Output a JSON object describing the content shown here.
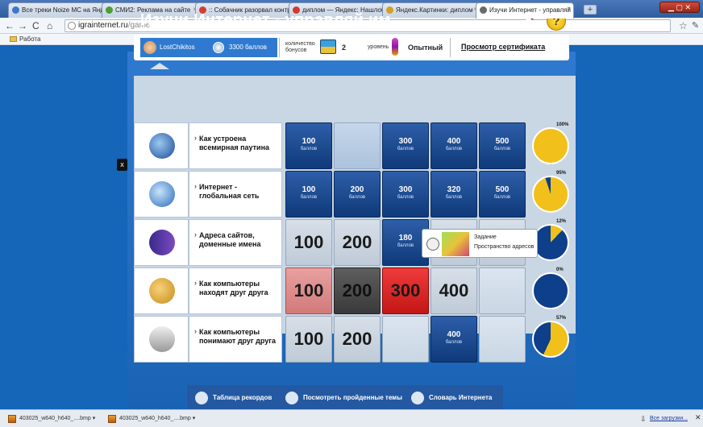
{
  "browser": {
    "tabs": [
      {
        "label": "Все треки Noize MC на Яндекс",
        "color": "#3a78c8"
      },
      {
        "label": "СМИ2: Реклама на сайте",
        "color": "#4aa030"
      },
      {
        "label": ":: Собачник разорвал контра",
        "color": "#d04030"
      },
      {
        "label": "диплом — Яндекс: Нашлось",
        "color": "#d03a2a"
      },
      {
        "label": "Яндекс.Картинки: диплом",
        "color": "#d0a020"
      },
      {
        "label": "Изучи Интернет - управляй",
        "color": "#6a6a6a"
      }
    ],
    "active_tab": 5,
    "url_domain": "igrainternet.ru",
    "url_path": "/game",
    "bookmark": "Работа",
    "win_ctl": "▁ ▢ ✕"
  },
  "game": {
    "title": "Изучи Интернет - управляй им",
    "help_label": "?",
    "user_name": "LostChikitos",
    "score": "3300 баллов",
    "bonus_label": "количество бонусов",
    "bonus_count": "2",
    "level_label": "уровень",
    "level_value": "Опытный",
    "cert_link": "Просмотр сертификата",
    "close_x": "x",
    "rows": [
      {
        "label": "Как устроена всемирная паутина",
        "pct": "100%",
        "progress": 1.0,
        "cells": [
          {
            "style": "blue",
            "value": "100",
            "unit": "баллов"
          },
          {
            "style": "glass",
            "value": "",
            "unit": ""
          },
          {
            "style": "blue",
            "value": "300",
            "unit": "баллов"
          },
          {
            "style": "blue",
            "value": "400",
            "unit": "баллов"
          },
          {
            "style": "blue",
            "value": "500",
            "unit": "баллов"
          }
        ]
      },
      {
        "label": "Интернет - глобальная сеть",
        "pct": "95%",
        "progress": 0.95,
        "cells": [
          {
            "style": "blue",
            "value": "100",
            "unit": "баллов"
          },
          {
            "style": "blue",
            "value": "200",
            "unit": "баллов"
          },
          {
            "style": "blue",
            "value": "300",
            "unit": "баллов"
          },
          {
            "style": "blue",
            "value": "320",
            "unit": "баллов"
          },
          {
            "style": "blue",
            "value": "500",
            "unit": "баллов"
          }
        ]
      },
      {
        "label": "Адреса сайтов, доменные имена",
        "pct": "12%",
        "progress": 0.12,
        "cells": [
          {
            "style": "gray",
            "big": "100"
          },
          {
            "style": "gray",
            "big": "200"
          },
          {
            "style": "blue",
            "value": "180",
            "unit": "баллов"
          },
          {
            "style": "gray",
            "big": ""
          },
          {
            "style": "gray",
            "big": ""
          }
        ]
      },
      {
        "label": "Как компьютеры находят друг друга",
        "pct": "0%",
        "progress": 0.0,
        "cells": [
          {
            "style": "red",
            "big": "100"
          },
          {
            "style": "dark",
            "big": "200"
          },
          {
            "style": "bred",
            "big": "300"
          },
          {
            "style": "gray",
            "big": "400"
          },
          {
            "style": "blank lt",
            "big": ""
          }
        ]
      },
      {
        "label": "Как компьютеры понимают друг друга",
        "pct": "57%",
        "progress": 0.57,
        "cells": [
          {
            "style": "gray",
            "big": "100"
          },
          {
            "style": "gray",
            "big": "200"
          },
          {
            "style": "blank lt",
            "big": ""
          },
          {
            "style": "blue",
            "value": "400",
            "unit": "баллов"
          },
          {
            "style": "blank lt",
            "big": ""
          }
        ]
      }
    ],
    "tooltip": {
      "line1": "Задание",
      "line2": "Пространство адресов"
    },
    "bottom": [
      {
        "label": "Таблица рекордов",
        "icon": "trophy-icon"
      },
      {
        "label": "Посмотреть пройденные темы",
        "icon": "eye-icon"
      },
      {
        "label": "Словарь Интернета",
        "icon": "book-icon"
      }
    ],
    "colors": {
      "page_bg": "#1565b9",
      "pie_fill": "#f2c01a",
      "pie_bg": "#0d3f8a",
      "cell_blue": "#123f80"
    }
  },
  "downloads": {
    "items": [
      "403025_w640_h640_....bmp",
      "403025_w640_h640_....bmp"
    ],
    "all_label": "Все загрузки...",
    "close": "✕"
  }
}
